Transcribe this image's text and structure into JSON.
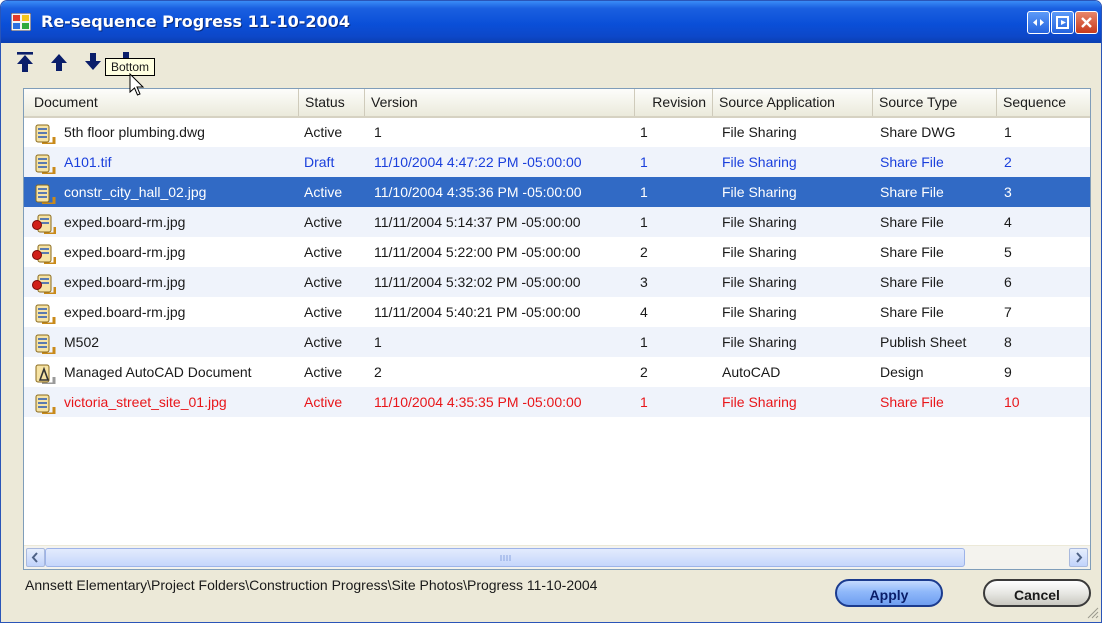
{
  "window": {
    "title": "Re-sequence Progress 11-10-2004"
  },
  "toolbar": {
    "tooltip": "Bottom",
    "buttons": [
      {
        "name": "move-top-button",
        "icon": "arrow-to-top-icon"
      },
      {
        "name": "move-up-button",
        "icon": "arrow-up-icon"
      },
      {
        "name": "move-down-button",
        "icon": "arrow-down-icon"
      },
      {
        "name": "move-bottom-button",
        "icon": "arrow-to-bottom-icon"
      }
    ]
  },
  "grid": {
    "columns": [
      "Document",
      "Status",
      "Version",
      "Revision",
      "Source Application",
      "Source Type",
      "Sequence"
    ],
    "rows": [
      {
        "doc": "5th floor plumbing.dwg",
        "status": "Active",
        "version": "1",
        "revision": "1",
        "app": "File Sharing",
        "type": "Share DWG",
        "seq": "1",
        "icon": "document-icon",
        "style": "normal"
      },
      {
        "doc": "A101.tif",
        "status": "Draft",
        "version": "11/10/2004 4:47:22 PM -05:00:00",
        "revision": "1",
        "app": "File Sharing",
        "type": "Share File",
        "seq": "2",
        "icon": "document-icon",
        "style": "blue"
      },
      {
        "doc": "constr_city_hall_02.jpg",
        "status": "Active",
        "version": "11/10/2004 4:35:36 PM -05:00:00",
        "revision": "1",
        "app": "File Sharing",
        "type": "Share File",
        "seq": "3",
        "icon": "document-icon",
        "style": "selected"
      },
      {
        "doc": "exped.board-rm.jpg",
        "status": "Active",
        "version": "11/11/2004 5:14:37 PM -05:00:00",
        "revision": "1",
        "app": "File Sharing",
        "type": "Share File",
        "seq": "4",
        "icon": "document-pin-icon",
        "style": "normal"
      },
      {
        "doc": "exped.board-rm.jpg",
        "status": "Active",
        "version": "11/11/2004 5:22:00 PM -05:00:00",
        "revision": "2",
        "app": "File Sharing",
        "type": "Share File",
        "seq": "5",
        "icon": "document-pin-icon",
        "style": "normal"
      },
      {
        "doc": "exped.board-rm.jpg",
        "status": "Active",
        "version": "11/11/2004 5:32:02 PM -05:00:00",
        "revision": "3",
        "app": "File Sharing",
        "type": "Share File",
        "seq": "6",
        "icon": "document-pin-icon",
        "style": "normal"
      },
      {
        "doc": "exped.board-rm.jpg",
        "status": "Active",
        "version": "11/11/2004 5:40:21 PM -05:00:00",
        "revision": "4",
        "app": "File Sharing",
        "type": "Share File",
        "seq": "7",
        "icon": "document-icon",
        "style": "normal"
      },
      {
        "doc": "M502",
        "status": "Active",
        "version": "1",
        "revision": "1",
        "app": "File Sharing",
        "type": "Publish Sheet",
        "seq": "8",
        "icon": "document-icon",
        "style": "normal"
      },
      {
        "doc": "Managed AutoCAD Document",
        "status": "Active",
        "version": "2",
        "revision": "2",
        "app": "AutoCAD",
        "type": "Design",
        "seq": "9",
        "icon": "autocad-document-icon",
        "style": "normal"
      },
      {
        "doc": "victoria_street_site_01.jpg",
        "status": "Active",
        "version": "11/10/2004 4:35:35 PM -05:00:00",
        "revision": "1",
        "app": "File Sharing",
        "type": "Share File",
        "seq": "10",
        "icon": "document-icon",
        "style": "red"
      }
    ]
  },
  "footer": {
    "path": "Annsett Elementary\\Project Folders\\Construction Progress\\Site Photos\\Progress 11-10-2004",
    "apply_label": "Apply",
    "cancel_label": "Cancel"
  },
  "colors": {
    "title_bar": "#0a4fd8",
    "selection": "#316ac5",
    "draft_text": "#1a3fdc",
    "alert_text": "#e8161a"
  }
}
